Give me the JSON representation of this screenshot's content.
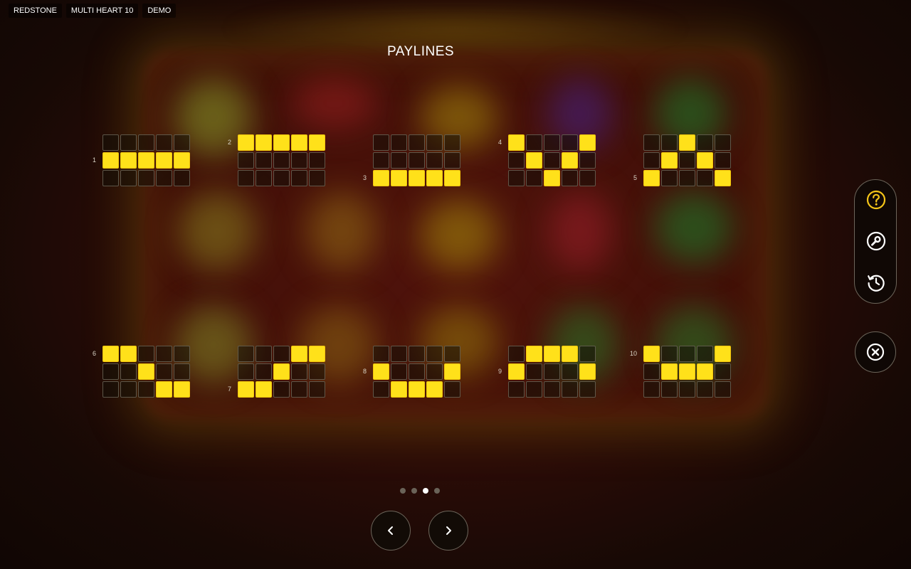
{
  "topbar": {
    "tags": [
      "REDSTONE",
      "MULTI HEART 10",
      "DEMO"
    ]
  },
  "title": "PAYLINES",
  "paylines": [
    {
      "number": "1",
      "rows": [
        [
          0,
          0,
          0,
          0,
          0
        ],
        [
          1,
          1,
          1,
          1,
          1
        ],
        [
          0,
          0,
          0,
          0,
          0
        ]
      ]
    },
    {
      "number": "2",
      "rows": [
        [
          1,
          1,
          1,
          1,
          1
        ],
        [
          0,
          0,
          0,
          0,
          0
        ],
        [
          0,
          0,
          0,
          0,
          0
        ]
      ]
    },
    {
      "number": "3",
      "rows": [
        [
          0,
          0,
          0,
          0,
          0
        ],
        [
          0,
          0,
          0,
          0,
          0
        ],
        [
          1,
          1,
          1,
          1,
          1
        ]
      ]
    },
    {
      "number": "4",
      "rows": [
        [
          1,
          0,
          0,
          0,
          1
        ],
        [
          0,
          1,
          0,
          1,
          0
        ],
        [
          0,
          0,
          1,
          0,
          0
        ]
      ]
    },
    {
      "number": "5",
      "rows": [
        [
          0,
          0,
          1,
          0,
          0
        ],
        [
          0,
          1,
          0,
          1,
          0
        ],
        [
          1,
          0,
          0,
          0,
          1
        ]
      ]
    },
    {
      "number": "6",
      "rows": [
        [
          1,
          1,
          0,
          0,
          0
        ],
        [
          0,
          0,
          1,
          0,
          0
        ],
        [
          0,
          0,
          0,
          1,
          1
        ]
      ]
    },
    {
      "number": "7",
      "rows": [
        [
          0,
          0,
          0,
          1,
          1
        ],
        [
          0,
          0,
          1,
          0,
          0
        ],
        [
          1,
          1,
          0,
          0,
          0
        ]
      ]
    },
    {
      "number": "8",
      "rows": [
        [
          0,
          0,
          0,
          0,
          0
        ],
        [
          1,
          0,
          0,
          0,
          1
        ],
        [
          0,
          1,
          1,
          1,
          0
        ]
      ]
    },
    {
      "number": "9",
      "rows": [
        [
          0,
          1,
          1,
          1,
          0
        ],
        [
          1,
          0,
          0,
          0,
          1
        ],
        [
          0,
          0,
          0,
          0,
          0
        ]
      ]
    },
    {
      "number": "10",
      "rows": [
        [
          1,
          0,
          0,
          0,
          1
        ],
        [
          0,
          1,
          1,
          1,
          0
        ],
        [
          0,
          0,
          0,
          0,
          0
        ]
      ]
    }
  ],
  "pagination": {
    "pages": 4,
    "active": 2
  },
  "nav": {
    "prev_icon": "chevron-left-icon",
    "next_icon": "chevron-right-icon"
  },
  "side_menu": {
    "help_icon": "help-icon",
    "settings_icon": "wrench-icon",
    "history_icon": "history-icon",
    "close_icon": "close-icon"
  },
  "colors": {
    "highlight": "#ffe11a",
    "help_accent": "#f5c518",
    "icon": "#ffffff"
  }
}
